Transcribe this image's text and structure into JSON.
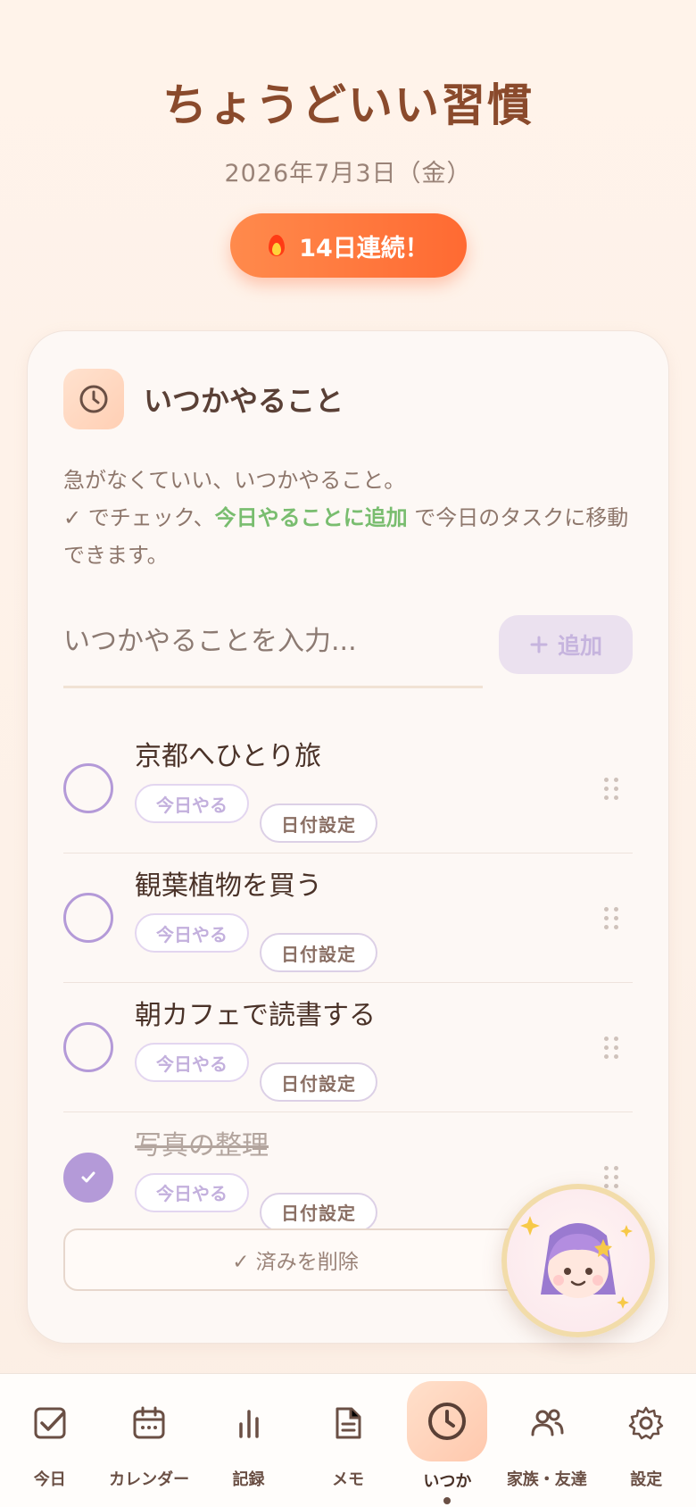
{
  "header": {
    "title": "ちょうどいい習慣",
    "date": "2026年7月3日（金）",
    "streak": "14日連続！"
  },
  "card": {
    "title": "いつかやること",
    "desc_line1": "急がなくていい、いつかやること。",
    "desc_check": "✓ でチェック、",
    "desc_highlight": "今日やることに追加",
    "desc_rest": " で今日のタスクに移動できます。",
    "input_placeholder": "いつかやることを入力...",
    "add_label": "追加",
    "add_icon": "plus-icon",
    "items": [
      {
        "text": "京都へひとり旅",
        "done": false,
        "today_label": "今日やる",
        "date_label": "日付設定"
      },
      {
        "text": "観葉植物を買う",
        "done": false,
        "today_label": "今日やる",
        "date_label": "日付設定"
      },
      {
        "text": "朝カフェで読書する",
        "done": false,
        "today_label": "今日やる",
        "date_label": "日付設定"
      },
      {
        "text": "写真の整理",
        "done": true,
        "today_label": "今日やる",
        "date_label": "日付設定"
      }
    ],
    "clear_done_label": "✓ 済みを削除"
  },
  "nav": {
    "items": [
      {
        "label": "今日",
        "icon": "checkbox-icon"
      },
      {
        "label": "カレンダー",
        "icon": "calendar-icon"
      },
      {
        "label": "記録",
        "icon": "bar-chart-icon"
      },
      {
        "label": "メモ",
        "icon": "document-icon"
      },
      {
        "label": "いつか",
        "icon": "clock-icon"
      },
      {
        "label": "家族・友達",
        "icon": "people-icon"
      },
      {
        "label": "設定",
        "icon": "gear-icon"
      }
    ],
    "active": "いつか"
  },
  "colors": {
    "accent": "#ff7a3c",
    "purple": "#b49ad8",
    "green": "#79bd6f",
    "title_brown": "#8a4a2c"
  }
}
